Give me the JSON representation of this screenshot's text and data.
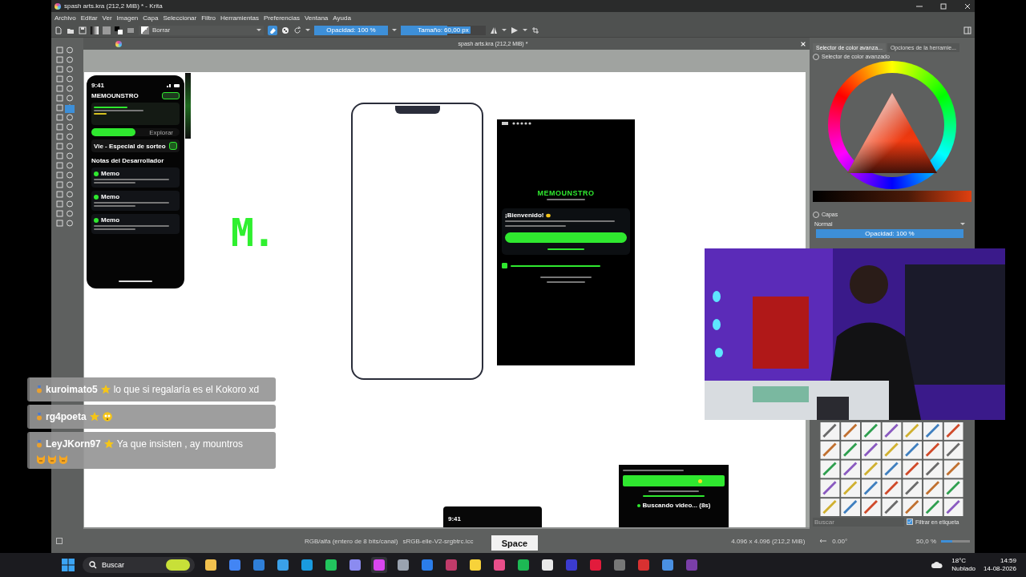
{
  "window": {
    "title": "spash arts.kra (212,2 MiB) * - Krita"
  },
  "menu": [
    "Archivo",
    "Editar",
    "Ver",
    "Imagen",
    "Capa",
    "Seleccionar",
    "Filtro",
    "Herramientas",
    "Preferencias",
    "Ventana",
    "Ayuda"
  ],
  "toolbar": {
    "brush_preset": "Borrar",
    "eraser_mode": {
      "on": true
    },
    "opacity": {
      "label": "Opacidad: 100 %",
      "level": 1
    },
    "size": {
      "label": "Tamaño: 60,00 px",
      "level": 0.55
    }
  },
  "document_tab": {
    "title": "spash arts.kra (212,2 MiB) *"
  },
  "canvas": {
    "home_mockup": {
      "time": "9:41",
      "app_name": "MEMOUNSTRO",
      "tab": "Explorar",
      "event": "Vie - Especial de sorteo",
      "section": "Notas del Desarrollador",
      "posts": [
        {
          "author": "Memo"
        },
        {
          "author": "Memo"
        },
        {
          "author": "Memo"
        }
      ]
    },
    "logo": "M.",
    "welcome_mockup": {
      "app_name": "MEMOUNSTRO",
      "greeting": "¡Bienvenido!",
      "terms_checked": true
    },
    "reward_mockup": {
      "status": "Buscando video... (8s)"
    },
    "lower_mockup": {
      "time": "9:41"
    }
  },
  "dock_tabs": [
    {
      "label": "Selector de color avanza...",
      "selected": true
    },
    {
      "label": "Opciones de la herramie...",
      "selected": false
    }
  ],
  "color_panel": {
    "title": "Selector de color avanzado"
  },
  "layers": {
    "title": "Capas",
    "blend_mode": "Normal",
    "opacity": {
      "label": "Opacidad: 100 %",
      "level": 1
    }
  },
  "brush_presets": {
    "search_placeholder": "Buscar",
    "filter_tag": {
      "label": "Filtrar en etiqueta",
      "checked": true
    }
  },
  "status_bar": {
    "color_space": "RGB/alfa (entero de 8 bits/canal)",
    "profile": "sRGB-elle-V2-srgbtrc.icc",
    "image_size": "4.096 x 4.096 (212,2 MiB)",
    "rotation": "0.00°",
    "zoom": "50,0 %",
    "zoom_slider": {
      "level": 0.4
    }
  },
  "key_overlay": "Space",
  "chat": [
    {
      "kind": "plain",
      "user": "kuroimato5",
      "text": "lo que si regalaría es el Kokoro xd"
    },
    {
      "kind": "face",
      "user": "rg4poeta"
    },
    {
      "kind": "cats",
      "user": "LeyJKorn97",
      "text": "Ya que insisten , ay mountros"
    }
  ],
  "taskbar": {
    "search_placeholder": "Buscar",
    "temperature": "18°C",
    "weather": "Nublado",
    "time": "14:59",
    "date": "14-08-2026"
  }
}
